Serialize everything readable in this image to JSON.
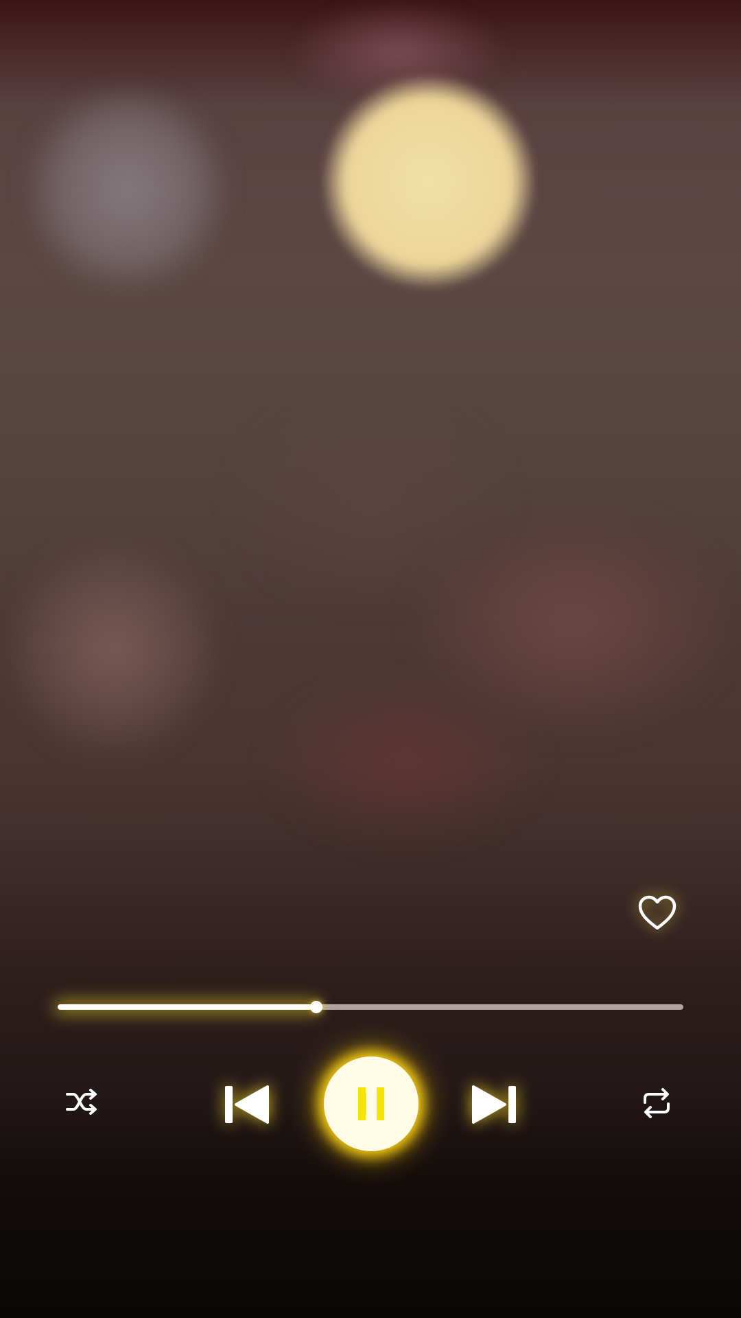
{
  "player": {
    "progress_fraction": 0.413,
    "is_playing": true,
    "accent_color": "#f5e400",
    "glow_color": "#ffd914",
    "track_color": "#dcd2d2",
    "fill_color": "#ffffff"
  },
  "icons": {
    "favorite": "heart-outline-icon",
    "shuffle": "shuffle-icon",
    "previous": "skip-previous-icon",
    "play_pause": "pause-icon",
    "next": "skip-next-icon",
    "repeat": "repeat-icon"
  }
}
